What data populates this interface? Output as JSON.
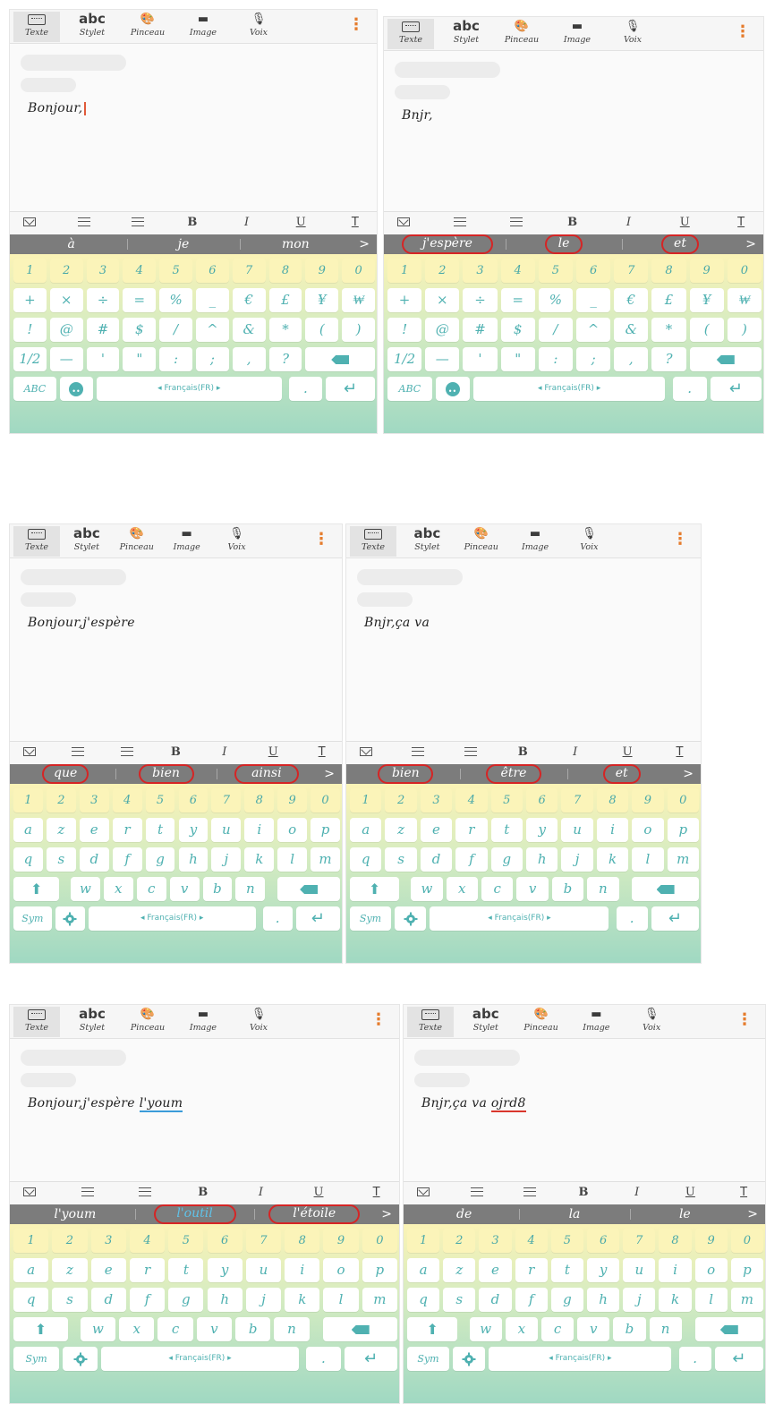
{
  "toolbar": {
    "items": [
      {
        "label": "Texte",
        "icon": "keyboard-icon"
      },
      {
        "label": "Stylet",
        "glyph": "abc",
        "icon": "abc-icon"
      },
      {
        "label": "Pinceau",
        "glyph": "🎨",
        "icon": "palette-icon"
      },
      {
        "label": "Image",
        "glyph": "▬",
        "icon": "image-icon"
      },
      {
        "label": "Voix",
        "glyph": "🎙",
        "icon": "microphone-icon"
      }
    ],
    "menu_glyph": "⋮"
  },
  "format_bar": {
    "bold": "B",
    "italic": "I",
    "underline": "U",
    "text": "T"
  },
  "keyboard": {
    "number_row": [
      "1",
      "2",
      "3",
      "4",
      "5",
      "6",
      "7",
      "8",
      "9",
      "0"
    ],
    "sym_row1": [
      "+",
      "×",
      "÷",
      "=",
      "%",
      "_",
      "€",
      "£",
      "¥",
      "₩"
    ],
    "sym_row2": [
      "!",
      "@",
      "#",
      "$",
      "/",
      "^",
      "&",
      "*",
      "(",
      ")"
    ],
    "sym_row3": [
      "1/2",
      "—",
      "'",
      "\"",
      ":",
      ";",
      ",",
      " ?"
    ],
    "alpha_row1": [
      "a",
      "z",
      "e",
      "r",
      "t",
      "y",
      "u",
      "i",
      "o",
      "p"
    ],
    "alpha_row2": [
      "q",
      "s",
      "d",
      "f",
      "g",
      "h",
      "j",
      "k",
      "l",
      "m"
    ],
    "alpha_row3": [
      "w",
      "x",
      "c",
      "v",
      "b",
      "n"
    ],
    "space_label": "◂ Français(FR) ▸",
    "abc_label": "ABC",
    "sym_label": "Sym",
    "period": ".",
    "enter_glyph": "↵",
    "shift_glyph": "⬆",
    "arrow": ">"
  },
  "panels": [
    {
      "note_pre": "Bonjour,",
      "note_mark": "",
      "mark_style": "",
      "caret": true,
      "suggestions": [
        {
          "text": "à",
          "circled": false,
          "blue": false
        },
        {
          "text": "je",
          "circled": false,
          "blue": false
        },
        {
          "text": "mon",
          "circled": false,
          "blue": false
        }
      ],
      "layout": "sym"
    },
    {
      "note_pre": "Bnjr,",
      "note_mark": "",
      "mark_style": "",
      "caret": false,
      "suggestions": [
        {
          "text": "j'espère",
          "circled": true,
          "blue": false
        },
        {
          "text": "le",
          "circled": true,
          "blue": false
        },
        {
          "text": "et",
          "circled": true,
          "blue": false
        }
      ],
      "layout": "sym"
    },
    {
      "note_pre": "Bonjour,j'espère",
      "note_mark": "",
      "mark_style": "",
      "caret": false,
      "suggestions": [
        {
          "text": "que",
          "circled": true,
          "blue": false
        },
        {
          "text": "bien",
          "circled": true,
          "blue": false
        },
        {
          "text": "ainsi",
          "circled": true,
          "blue": false
        }
      ],
      "layout": "alpha"
    },
    {
      "note_pre": "Bnjr,ça va",
      "note_mark": "",
      "mark_style": "",
      "caret": false,
      "suggestions": [
        {
          "text": "bien",
          "circled": true,
          "blue": false
        },
        {
          "text": "être",
          "circled": true,
          "blue": false
        },
        {
          "text": "et",
          "circled": true,
          "blue": false
        }
      ],
      "layout": "alpha"
    },
    {
      "note_pre": "Bonjour,j'espère ",
      "note_mark": "l'youm",
      "mark_style": "blue",
      "caret": false,
      "suggestions": [
        {
          "text": "l'youm",
          "circled": false,
          "blue": false
        },
        {
          "text": "l'outil",
          "circled": true,
          "blue": true
        },
        {
          "text": "l'étoile",
          "circled": true,
          "blue": false
        }
      ],
      "layout": "alpha"
    },
    {
      "note_pre": "Bnjr,ça va ",
      "note_mark": "ojrd8",
      "mark_style": "red",
      "caret": false,
      "suggestions": [
        {
          "text": "de",
          "circled": false,
          "blue": false
        },
        {
          "text": "la",
          "circled": false,
          "blue": false
        },
        {
          "text": "le",
          "circled": false,
          "blue": false
        }
      ],
      "layout": "alpha"
    }
  ]
}
